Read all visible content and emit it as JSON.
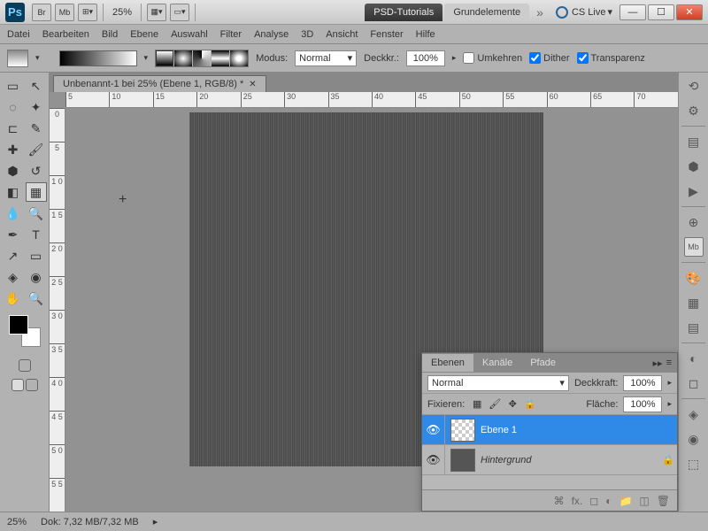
{
  "title": {
    "zoom": "25%",
    "tab1": "PSD-Tutorials",
    "tab2": "Grundelemente",
    "cslive": "CS Live"
  },
  "menu": [
    "Datei",
    "Bearbeiten",
    "Bild",
    "Ebene",
    "Auswahl",
    "Filter",
    "Analyse",
    "3D",
    "Ansicht",
    "Fenster",
    "Hilfe"
  ],
  "opt": {
    "modus_lbl": "Modus:",
    "modus_val": "Normal",
    "deck_lbl": "Deckkr.:",
    "deck_val": "100%",
    "umkehren": "Umkehren",
    "dither": "Dither",
    "transp": "Transparenz"
  },
  "doc": {
    "tab": "Unbenannt-1 bei 25% (Ebene 1, RGB/8) *"
  },
  "ruler_h": [
    "5",
    "10",
    "15",
    "20",
    "25",
    "30",
    "35",
    "40",
    "45",
    "50",
    "55",
    "60",
    "65",
    "70"
  ],
  "ruler_v": [
    "0",
    "5",
    "1 0",
    "1 5",
    "2 0",
    "2 5",
    "3 0",
    "3 5",
    "4 0",
    "4 5",
    "5 0",
    "5 5"
  ],
  "layers": {
    "tabs": [
      "Ebenen",
      "Kanäle",
      "Pfade"
    ],
    "blend_val": "Normal",
    "opac_lbl": "Deckkraft:",
    "opac_val": "100%",
    "lock_lbl": "Fixieren:",
    "fill_lbl": "Fläche:",
    "fill_val": "100%",
    "items": [
      {
        "name": "Ebene 1"
      },
      {
        "name": "Hintergrund"
      }
    ]
  },
  "status": {
    "zoom": "25%",
    "doc": "Dok: 7,32 MB/7,32 MB"
  }
}
